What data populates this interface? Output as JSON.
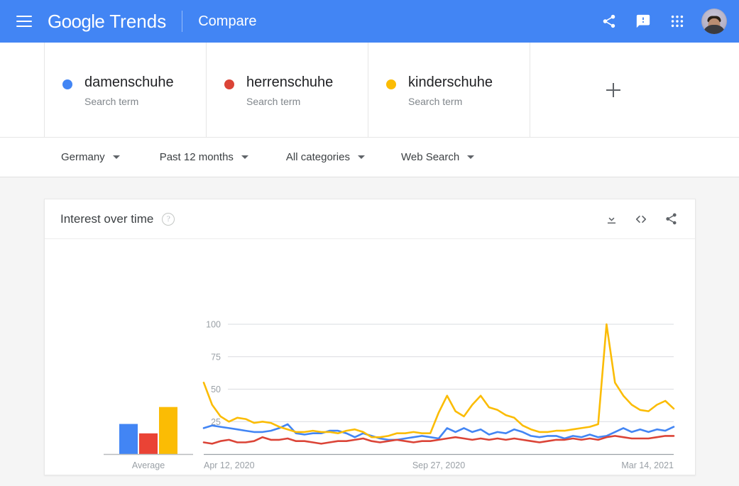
{
  "appbar": {
    "menu_icon": "hamburger-menu-icon",
    "brand_google": "Google",
    "brand_product": "Trends",
    "section": "Compare",
    "share_icon": "share-icon",
    "feedback_icon": "feedback-icon",
    "apps_icon": "apps-grid-icon",
    "avatar_icon": "user-avatar",
    "background": "#4285f4"
  },
  "compare": {
    "terms": [
      {
        "name": "damenschuhe",
        "type": "Search term",
        "color": "#4285f4"
      },
      {
        "name": "herrenschuhe",
        "type": "Search term",
        "color": "#db4437"
      },
      {
        "name": "kinderschuhe",
        "type": "Search term",
        "color": "#fbbc04"
      }
    ],
    "add_label": "+"
  },
  "filters": [
    {
      "label": "Germany",
      "name": "location-filter"
    },
    {
      "label": "Past 12 months",
      "name": "time-range-filter"
    },
    {
      "label": "All categories",
      "name": "category-filter"
    },
    {
      "label": "Web Search",
      "name": "search-type-filter"
    }
  ],
  "card": {
    "title": "Interest over time",
    "help_icon": "help-circle-icon",
    "download_icon": "download-icon",
    "embed_icon": "embed-code-icon",
    "share_icon": "share-icon"
  },
  "chart_data": {
    "type": "line",
    "title": "Interest over time",
    "xlabel": "",
    "ylabel": "",
    "ylim": [
      0,
      100
    ],
    "yticks": [
      25,
      50,
      75,
      100
    ],
    "grid": true,
    "legend": "none",
    "xtick_labels": [
      "Apr 12, 2020",
      "Sep 27, 2020",
      "Mar 14, 2021"
    ],
    "xtick_positions": [
      0,
      0.5,
      1.0
    ],
    "series": [
      {
        "name": "damenschuhe",
        "color": "#4285f4",
        "values": [
          20,
          22,
          21,
          20,
          19,
          18,
          17,
          17,
          18,
          20,
          23,
          16,
          15,
          16,
          16,
          18,
          18,
          16,
          13,
          16,
          14,
          12,
          11,
          11,
          12,
          13,
          14,
          13,
          12,
          20,
          17,
          20,
          17,
          19,
          15,
          17,
          16,
          19,
          17,
          14,
          13,
          14,
          14,
          12,
          14,
          13,
          15,
          13,
          14,
          17,
          20,
          17,
          19,
          17,
          19,
          18,
          21
        ]
      },
      {
        "name": "herrenschuhe",
        "color": "#db4437",
        "values": [
          9,
          8,
          10,
          11,
          9,
          9,
          10,
          13,
          11,
          11,
          12,
          10,
          10,
          9,
          8,
          9,
          10,
          10,
          11,
          12,
          10,
          9,
          10,
          11,
          10,
          9,
          10,
          10,
          11,
          12,
          13,
          12,
          11,
          12,
          11,
          12,
          11,
          12,
          11,
          10,
          9,
          10,
          11,
          11,
          12,
          11,
          12,
          11,
          13,
          14,
          13,
          12,
          12,
          12,
          13,
          14,
          14
        ]
      },
      {
        "name": "kinderschuhe",
        "color": "#fbbc04",
        "values": [
          55,
          38,
          29,
          25,
          28,
          27,
          24,
          25,
          24,
          21,
          19,
          17,
          17,
          18,
          17,
          17,
          16,
          18,
          19,
          17,
          13,
          13,
          14,
          16,
          16,
          17,
          16,
          16,
          32,
          45,
          33,
          29,
          38,
          45,
          36,
          34,
          30,
          28,
          22,
          19,
          17,
          17,
          18,
          18,
          19,
          20,
          21,
          23,
          100,
          55,
          45,
          38,
          34,
          33,
          38,
          41,
          35
        ]
      }
    ],
    "average_bars": {
      "label": "Average",
      "categories": [
        "damenschuhe",
        "herrenschuhe",
        "kinderschuhe"
      ],
      "values": [
        16,
        11,
        25
      ],
      "colors": [
        "#4285f4",
        "#ea4335",
        "#fbbc04"
      ]
    }
  }
}
